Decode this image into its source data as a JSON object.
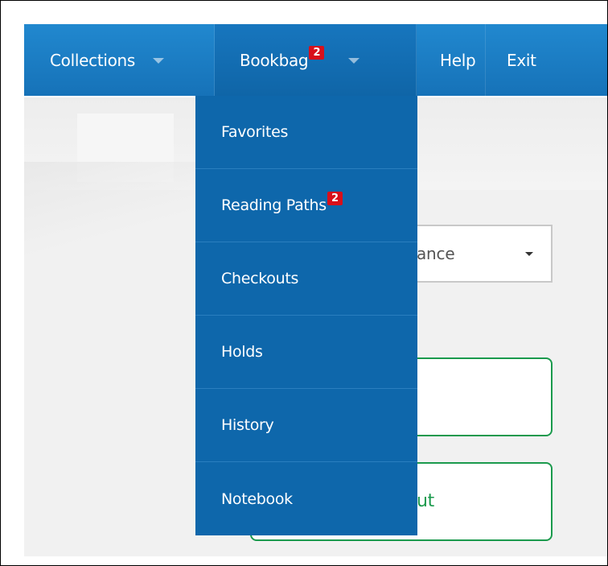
{
  "nav": {
    "collections": "Collections",
    "bookbag": "Bookbag",
    "bookbag_badge": "2",
    "help": "Help",
    "exit": "Exit"
  },
  "dropdown": {
    "items": [
      {
        "label": "Favorites"
      },
      {
        "label": "Reading Paths",
        "badge": "2"
      },
      {
        "label": "Checkouts"
      },
      {
        "label": "Holds"
      },
      {
        "label": "History"
      },
      {
        "label": "Notebook"
      }
    ]
  },
  "page": {
    "select_partial_text": "ance",
    "button2_partial_text": "ut"
  },
  "colors": {
    "nav_blue": "#1a7cc4",
    "dropdown_blue": "#0e67ab",
    "badge_red": "#d8101b",
    "button_green": "#1b9a4d"
  }
}
